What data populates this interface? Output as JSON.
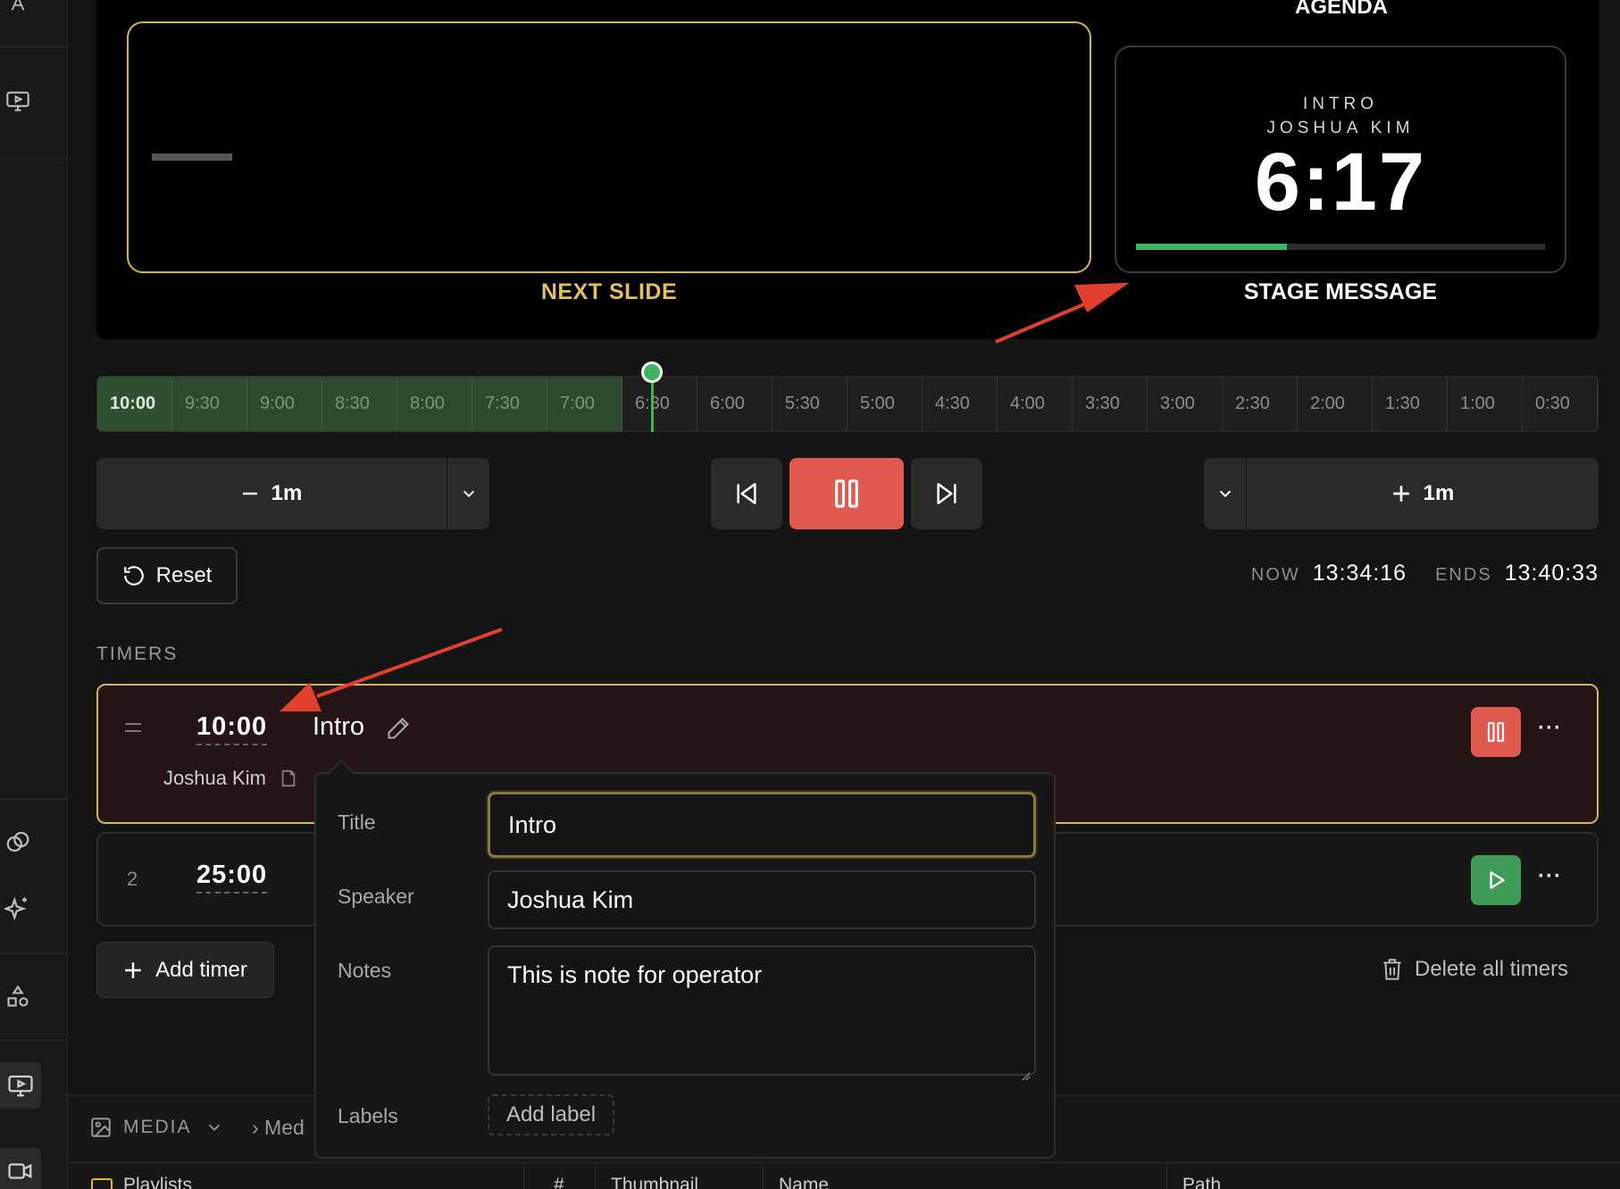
{
  "preview": {
    "next_slide_label": "NEXT SLIDE",
    "agenda_label": "AGENDA",
    "stage_title": "INTRO",
    "stage_speaker": "JOSHUA KIM",
    "stage_time": "6:17",
    "stage_progress": 0.37,
    "stage_message_label": "STAGE MESSAGE",
    "accent_color": "#d2b45a",
    "progress_color": "#3fb45f"
  },
  "timeline": {
    "ticks": [
      "10:00",
      "9:30",
      "9:00",
      "8:30",
      "8:00",
      "7:30",
      "7:00",
      "6:30",
      "6:00",
      "5:30",
      "5:00",
      "4:30",
      "4:00",
      "3:30",
      "3:00",
      "2:30",
      "2:00",
      "1:30",
      "1:00",
      "0:30"
    ],
    "elapsed_ticks": 7,
    "playhead_fraction": 0.37
  },
  "transport": {
    "minus_label": "1m",
    "plus_label": "1m",
    "reset_label": "Reset",
    "pause_color": "#e05a4f"
  },
  "clock": {
    "now_label": "NOW",
    "now_value": "13:34:16",
    "ends_label": "ENDS",
    "ends_value": "13:40:33"
  },
  "timers": {
    "section_label": "TIMERS",
    "items": [
      {
        "index": "",
        "time": "10:00",
        "title": "Intro",
        "speaker": "Joshua Kim",
        "state": "running"
      },
      {
        "index": "2",
        "time": "25:00",
        "title": "",
        "speaker": "",
        "state": "idle"
      }
    ],
    "add_timer_label": "Add timer",
    "delete_all_label": "Delete all timers"
  },
  "editor": {
    "title_label": "Title",
    "title_value": "Intro",
    "speaker_label": "Speaker",
    "speaker_value": "Joshua Kim",
    "notes_label": "Notes",
    "notes_value": "This is note for operator",
    "labels_label": "Labels",
    "add_label": "Add label"
  },
  "media": {
    "section_label": "MEDIA",
    "breadcrumb": "› Med",
    "columns": [
      "Playlists",
      "#",
      "Thumbnail",
      "Name",
      "Path"
    ]
  }
}
